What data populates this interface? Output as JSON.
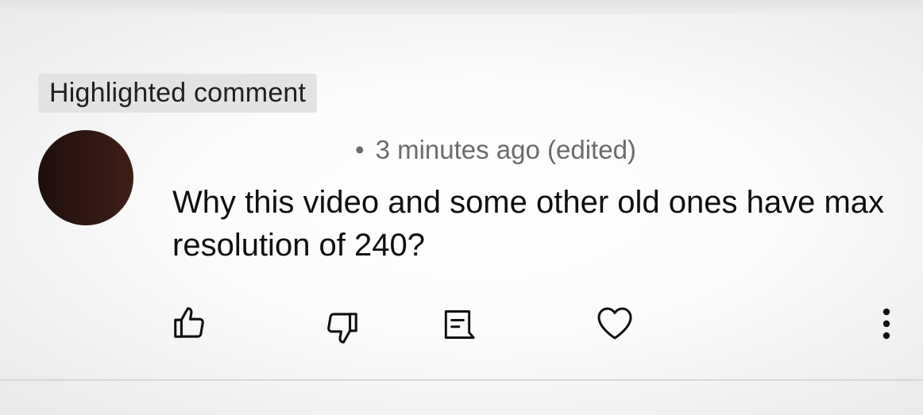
{
  "comment": {
    "highlight_label": "Highlighted comment",
    "meta_dot": "•",
    "meta_text": "3 minutes ago (edited)",
    "body": "Why this video and some other old ones have max resolution of 240?"
  },
  "actions": [
    {
      "name": "like",
      "icon": "thumbs-up-icon"
    },
    {
      "name": "dislike",
      "icon": "thumbs-down-icon"
    },
    {
      "name": "reply",
      "icon": "reply-comment-icon"
    },
    {
      "name": "heart",
      "icon": "heart-icon"
    },
    {
      "name": "more",
      "icon": "vertical-ellipsis-icon"
    }
  ],
  "colors": {
    "badge_bg": "#e3e3e3",
    "text_primary": "#0f0f0f",
    "text_secondary": "#6b6b6b",
    "avatar": "#2f1712"
  }
}
